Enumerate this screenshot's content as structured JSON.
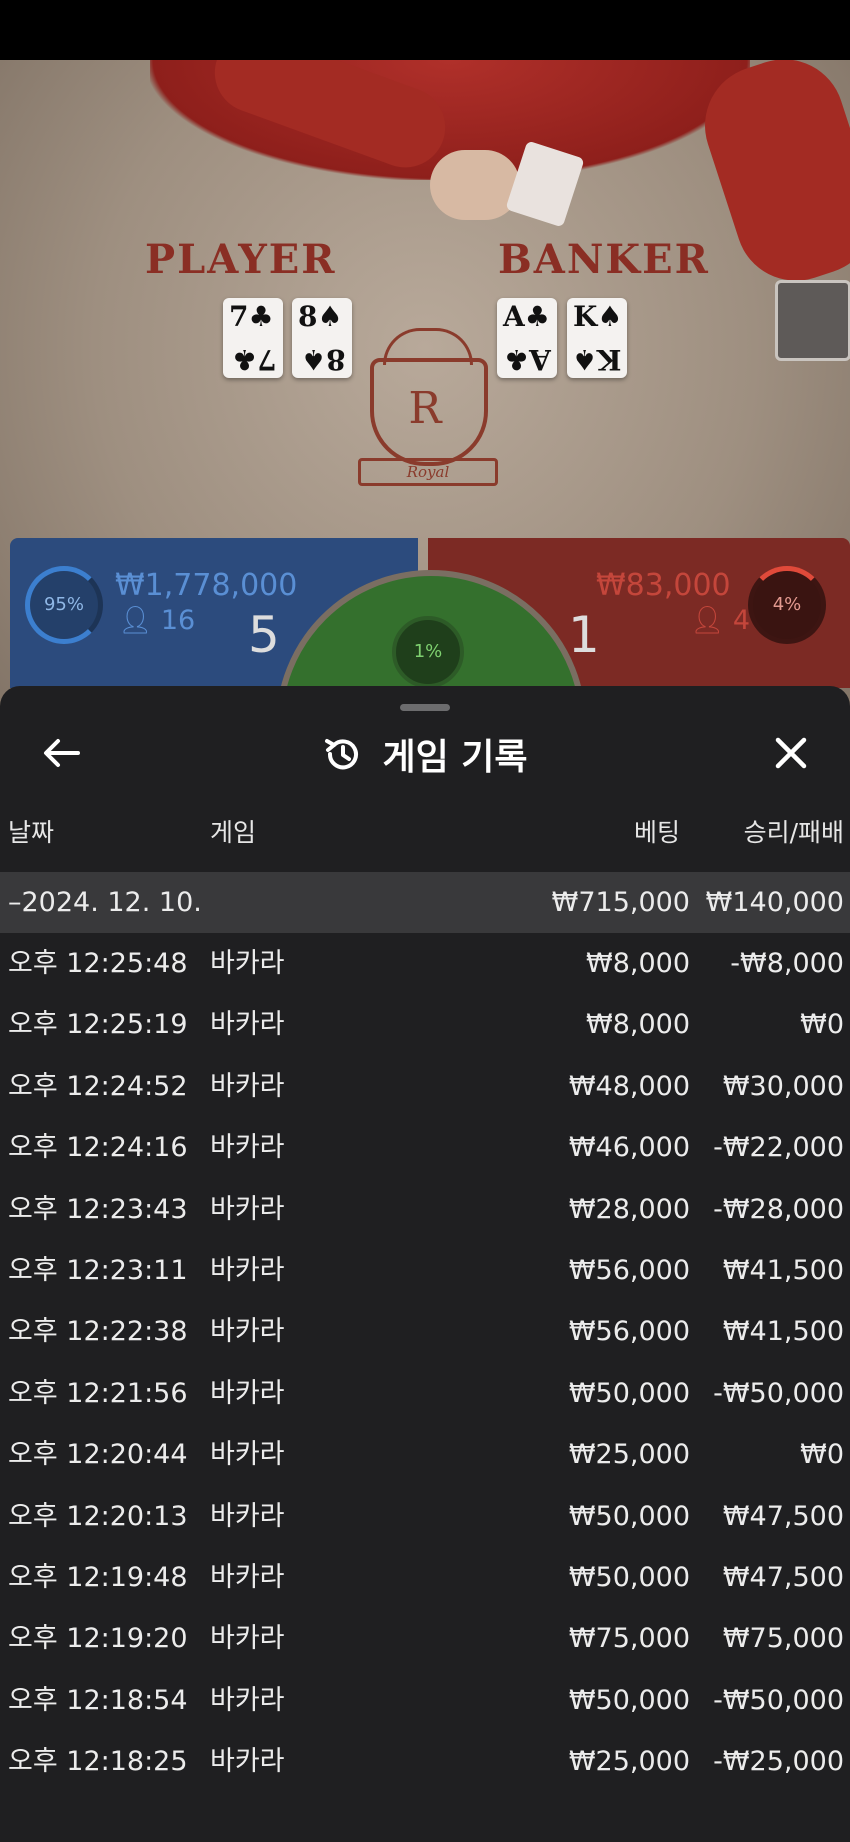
{
  "table": {
    "player_label": "PLAYER",
    "banker_label": "BANKER",
    "player_cards": [
      {
        "rank": "7",
        "suit": "♣"
      },
      {
        "rank": "8",
        "suit": "♠"
      }
    ],
    "banker_cards": [
      {
        "rank": "A",
        "suit": "♣"
      },
      {
        "rank": "K",
        "suit": "♠"
      }
    ],
    "logo_letter": "R",
    "logo_ribbon": "Royal"
  },
  "bets": {
    "player": {
      "percent": "95%",
      "amount": "₩1,778,000",
      "players": "16",
      "score": "5",
      "color": "#2c4b7d"
    },
    "banker": {
      "percent": "4%",
      "amount": "₩83,000",
      "players": "4",
      "score": "1",
      "color": "#7c2a24"
    },
    "tie": {
      "percent": "1%",
      "color": "#34702d"
    }
  },
  "sheet": {
    "title": "게임 기록",
    "columns": {
      "date": "날짜",
      "game": "게임",
      "bet": "베팅",
      "result": "승리/패배"
    },
    "date_group": {
      "date": "–2024. 12. 10.",
      "bet": "₩715,000",
      "result": "₩140,000"
    },
    "rows": [
      {
        "time": "오후 12:25:48",
        "game": "바카라",
        "bet": "₩8,000",
        "result": "-₩8,000"
      },
      {
        "time": "오후 12:25:19",
        "game": "바카라",
        "bet": "₩8,000",
        "result": "₩0"
      },
      {
        "time": "오후 12:24:52",
        "game": "바카라",
        "bet": "₩48,000",
        "result": "₩30,000"
      },
      {
        "time": "오후 12:24:16",
        "game": "바카라",
        "bet": "₩46,000",
        "result": "-₩22,000"
      },
      {
        "time": "오후 12:23:43",
        "game": "바카라",
        "bet": "₩28,000",
        "result": "-₩28,000"
      },
      {
        "time": "오후 12:23:11",
        "game": "바카라",
        "bet": "₩56,000",
        "result": "₩41,500"
      },
      {
        "time": "오후 12:22:38",
        "game": "바카라",
        "bet": "₩56,000",
        "result": "₩41,500"
      },
      {
        "time": "오후 12:21:56",
        "game": "바카라",
        "bet": "₩50,000",
        "result": "-₩50,000"
      },
      {
        "time": "오후 12:20:44",
        "game": "바카라",
        "bet": "₩25,000",
        "result": "₩0"
      },
      {
        "time": "오후 12:20:13",
        "game": "바카라",
        "bet": "₩50,000",
        "result": "₩47,500"
      },
      {
        "time": "오후 12:19:48",
        "game": "바카라",
        "bet": "₩50,000",
        "result": "₩47,500"
      },
      {
        "time": "오후 12:19:20",
        "game": "바카라",
        "bet": "₩75,000",
        "result": "₩75,000"
      },
      {
        "time": "오후 12:18:54",
        "game": "바카라",
        "bet": "₩50,000",
        "result": "-₩50,000"
      },
      {
        "time": "오후 12:18:25",
        "game": "바카라",
        "bet": "₩25,000",
        "result": "-₩25,000"
      }
    ],
    "icons": {
      "back": "arrow-left-icon",
      "history": "history-icon",
      "close": "close-icon"
    }
  }
}
